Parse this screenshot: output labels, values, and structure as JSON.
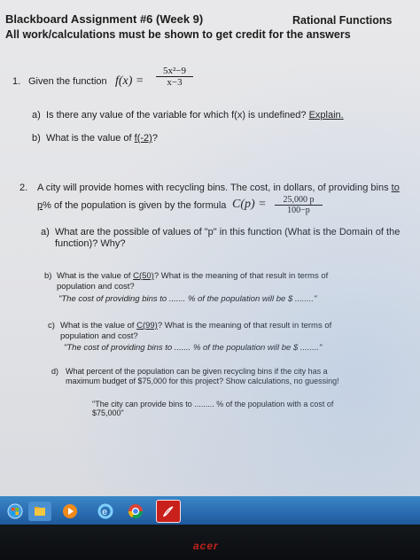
{
  "header": {
    "title": "Blackboard Assignment #6 (Week 9)",
    "topic": "Rational Functions",
    "instructions": "All work/calculations must be shown to get credit for the answers"
  },
  "q1": {
    "number": "1.",
    "prompt": "Given the function",
    "fx": "f(x) =",
    "numerator": "5x²−9",
    "denominator": "x−3",
    "a_label": "a)",
    "a_text": "Is there any value of the variable for which f(x) is undefined?",
    "a_link": "Explain.",
    "b_label": "b)",
    "b_text": "What is the value of",
    "b_link": "f(-2)",
    "b_end": "?"
  },
  "q2": {
    "number": "2.",
    "line1": "A city will provide homes with recycling bins. The cost, in dollars, of providing bins",
    "line1_end": "to",
    "line2_start": "p",
    "line2": "% of the population is given by the formula",
    "cp": "C(p) =",
    "numerator": "25,000 p",
    "denominator": "100−p",
    "a_label": "a)",
    "a_text1": "What are the possible of values of \"p\" in this function (What is the Domain of the",
    "a_text2": "function)? Why?",
    "b_label": "b)",
    "b_text1_pre": "What is the value of",
    "b_text1_link": "C(50)",
    "b_text1_post": "? What is the meaning of that result in terms of",
    "b_text2": "population and cost?",
    "b_text3": "\"The cost of providing bins to ....... % of the population will be $ ........\"",
    "c_label": "c)",
    "c_text1_pre": "What is the value of",
    "c_text1_link": "C(99)",
    "c_text1_post": "? What is the meaning of that result in terms of",
    "c_text2": "population and cost?",
    "c_text3": "\"The cost of providing bins to ....... % of the population will be $ ........\"",
    "d_label": "d)",
    "d_text1": "What percent of the population can be given recycling bins if the city has a",
    "d_text2": "maximum budget of $75,000 for this project? Show calculations, no guessing!",
    "d_text3": "\"The city can provide bins to ......... % of the population with a cost of",
    "d_text4": "$75,000\""
  },
  "colors": {
    "taskbar": "#2a6bb0",
    "ink": "#1c1c1c",
    "screen": "#e6e7ea"
  },
  "taskbar_icons": [
    "windows-start-icon",
    "file-explorer-icon",
    "media-player-icon",
    "internet-explorer-icon",
    "chrome-icon",
    "acrobat-icon"
  ],
  "bezel_logo": "acer"
}
